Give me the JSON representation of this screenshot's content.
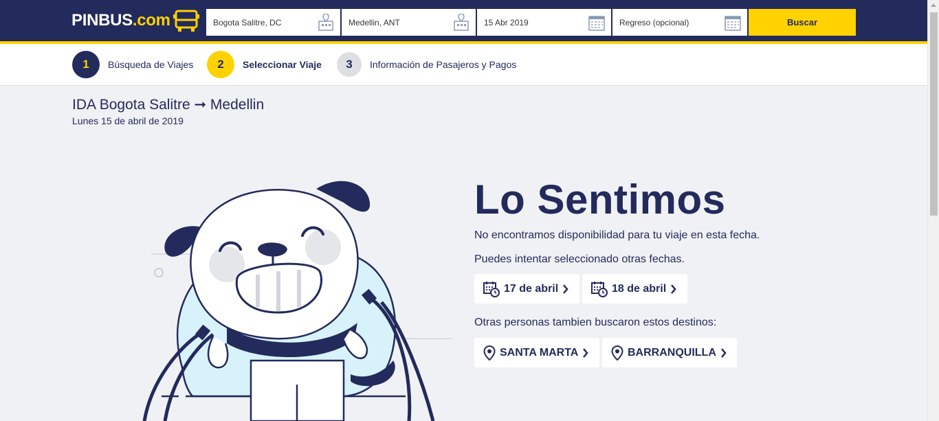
{
  "header": {
    "logo_main": "PINBUS",
    "logo_suffix": ".com",
    "origin": "Bogota Salitre, DC",
    "destination": "Medellin, ANT",
    "departure_date": "15 Abr 2019",
    "return_date": "Regreso (opcional)",
    "search_label": "Buscar",
    "icons": [
      "location-building-icon",
      "calendar-icon",
      "bus-icon"
    ],
    "colors": {
      "navy": "#232a5c",
      "yellow": "#ffd200"
    }
  },
  "steps": [
    {
      "number": "1",
      "label": "Búsqueda de Viajes"
    },
    {
      "number": "2",
      "label": "Seleccionar Viaje"
    },
    {
      "number": "3",
      "label": "Información de Pasajeros y Pagos"
    }
  ],
  "trip": {
    "direction": "IDA",
    "origin": "Bogota Salitre",
    "arrow": "➞",
    "destination": "Medellin",
    "date": "Lunes 15 de abril de 2019"
  },
  "message": {
    "title": "Lo Sentimos",
    "no_availability": "No encontramos disponibilidad para tu viaje en esta fecha.",
    "try_other_dates": "Puedes intentar seleccionado otras fechas.",
    "other_destinations": "Otras personas tambien buscaron estos destinos:"
  },
  "alt_dates": [
    {
      "label": "17 de abril"
    },
    {
      "label": "18 de abril"
    }
  ],
  "alt_destinations": [
    {
      "label": "SANTA MARTA"
    },
    {
      "label": "BARRANQUILLA"
    }
  ]
}
